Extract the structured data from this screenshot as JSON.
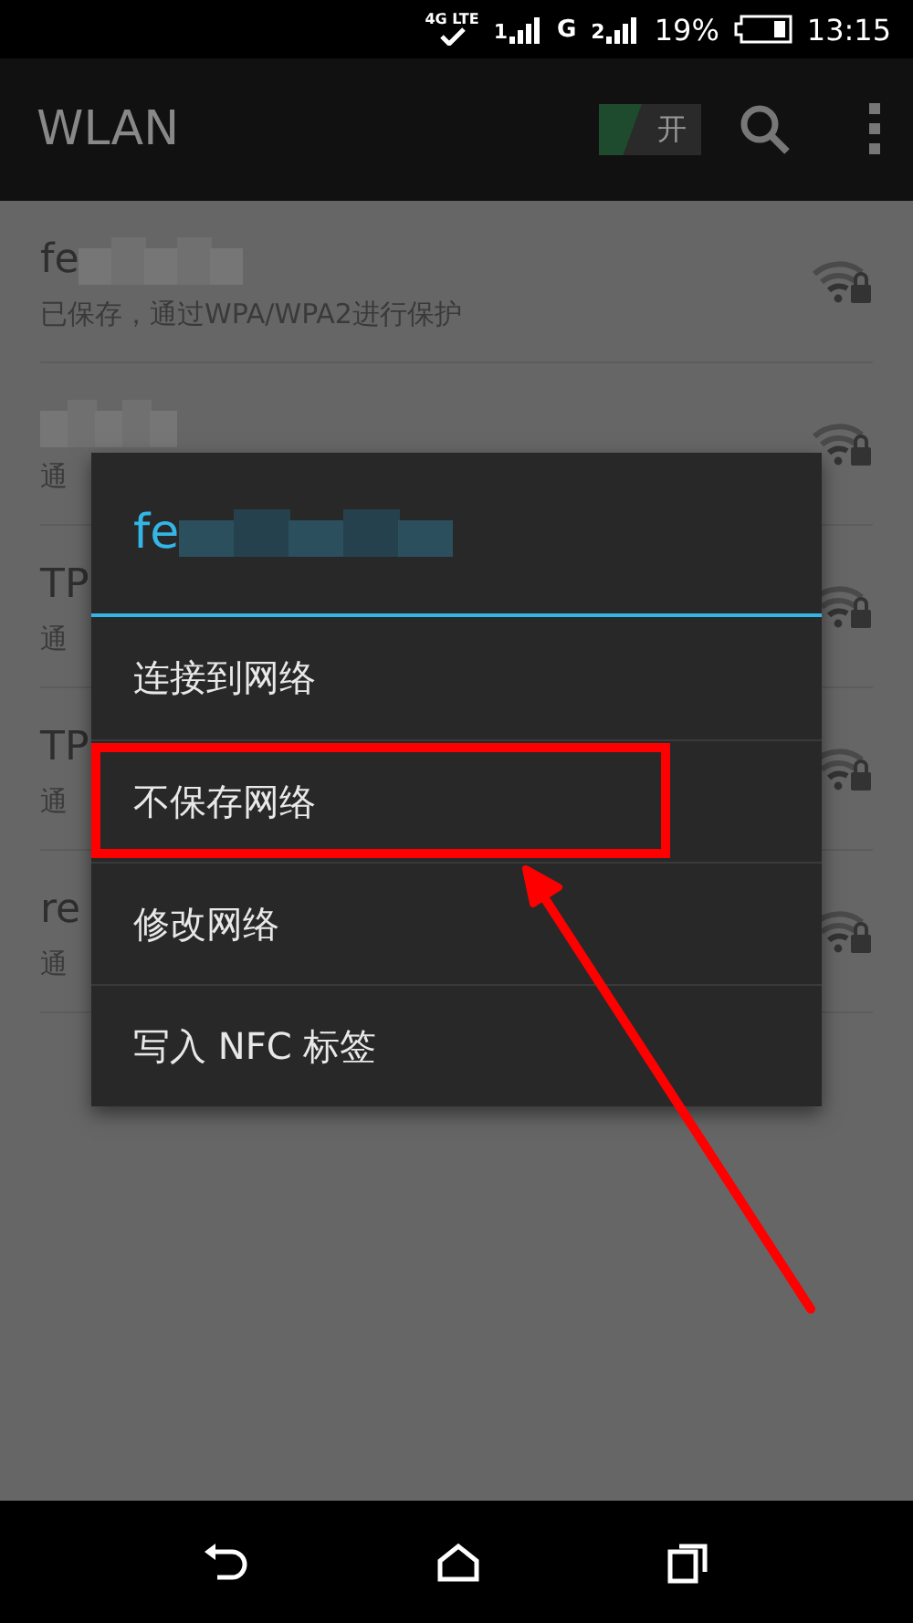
{
  "status_bar": {
    "network_label": "4G LTE",
    "sim1_label": "1",
    "data_type": "G",
    "sim2_label": "2",
    "battery": "19%",
    "time": "13:15"
  },
  "app_bar": {
    "title": "WLAN",
    "switch": {
      "label": "开",
      "on": true
    }
  },
  "networks": [
    {
      "name": "fe",
      "blurred": true,
      "status": "已保存，通过WPA/WPA2进行保护"
    },
    {
      "blurred": true,
      "status": "通"
    },
    {
      "name": "TP",
      "blurred": false,
      "status": "通"
    },
    {
      "name": "TP",
      "blurred": false,
      "status": "通"
    },
    {
      "name": "re",
      "blurred": false,
      "status": "通"
    }
  ],
  "dialog": {
    "title": "fe",
    "title_blurred": true,
    "items": [
      {
        "label": "连接到网络",
        "highlighted": false
      },
      {
        "label": "不保存网络",
        "highlighted": true
      },
      {
        "label": "修改网络",
        "highlighted": false
      },
      {
        "label": "写入 NFC 标签",
        "highlighted": false
      }
    ]
  }
}
